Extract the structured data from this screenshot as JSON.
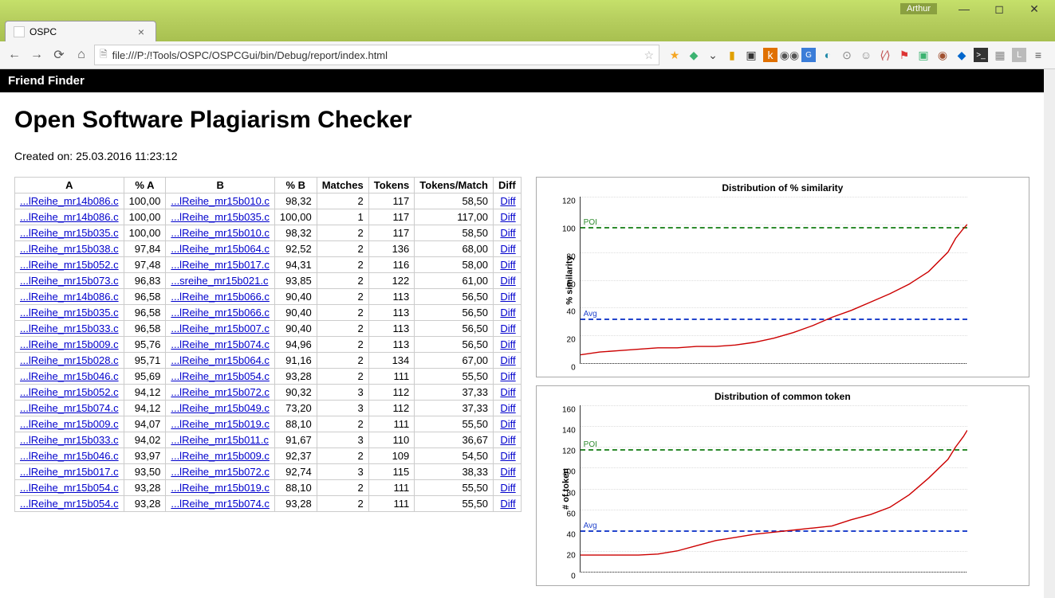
{
  "window": {
    "user": "Arthur"
  },
  "browser": {
    "tab_title": "OSPC",
    "url": "file:///P:/!Tools/OSPC/OSPCGui/bin/Debug/report/index.html"
  },
  "page": {
    "header": "Friend Finder",
    "title": "Open Software Plagiarism Checker",
    "created_label": "Created on:",
    "created_value": "25.03.2016 11:23:12"
  },
  "table": {
    "headers": {
      "a": "A",
      "pa": "% A",
      "b": "B",
      "pb": "% B",
      "matches": "Matches",
      "tokens": "Tokens",
      "tpm": "Tokens/Match",
      "diff": "Diff"
    },
    "diff_label": "Diff",
    "rows": [
      {
        "a": "...lReihe_mr14b086.c",
        "pa": "100,00",
        "b": "...lReihe_mr15b010.c",
        "pb": "98,32",
        "matches": "2",
        "tokens": "117",
        "tpm": "58,50"
      },
      {
        "a": "...lReihe_mr14b086.c",
        "pa": "100,00",
        "b": "...lReihe_mr15b035.c",
        "pb": "100,00",
        "matches": "1",
        "tokens": "117",
        "tpm": "117,00"
      },
      {
        "a": "...lReihe_mr15b035.c",
        "pa": "100,00",
        "b": "...lReihe_mr15b010.c",
        "pb": "98,32",
        "matches": "2",
        "tokens": "117",
        "tpm": "58,50"
      },
      {
        "a": "...lReihe_mr15b038.c",
        "pa": "97,84",
        "b": "...lReihe_mr15b064.c",
        "pb": "92,52",
        "matches": "2",
        "tokens": "136",
        "tpm": "68,00"
      },
      {
        "a": "...lReihe_mr15b052.c",
        "pa": "97,48",
        "b": "...lReihe_mr15b017.c",
        "pb": "94,31",
        "matches": "2",
        "tokens": "116",
        "tpm": "58,00"
      },
      {
        "a": "...lReihe_mr15b073.c",
        "pa": "96,83",
        "b": "...sreihe_mr15b021.c",
        "pb": "93,85",
        "matches": "2",
        "tokens": "122",
        "tpm": "61,00"
      },
      {
        "a": "...lReihe_mr14b086.c",
        "pa": "96,58",
        "b": "...lReihe_mr15b066.c",
        "pb": "90,40",
        "matches": "2",
        "tokens": "113",
        "tpm": "56,50"
      },
      {
        "a": "...lReihe_mr15b035.c",
        "pa": "96,58",
        "b": "...lReihe_mr15b066.c",
        "pb": "90,40",
        "matches": "2",
        "tokens": "113",
        "tpm": "56,50"
      },
      {
        "a": "...lReihe_mr15b033.c",
        "pa": "96,58",
        "b": "...lReihe_mr15b007.c",
        "pb": "90,40",
        "matches": "2",
        "tokens": "113",
        "tpm": "56,50"
      },
      {
        "a": "...lReihe_mr15b009.c",
        "pa": "95,76",
        "b": "...lReihe_mr15b074.c",
        "pb": "94,96",
        "matches": "2",
        "tokens": "113",
        "tpm": "56,50"
      },
      {
        "a": "...lReihe_mr15b028.c",
        "pa": "95,71",
        "b": "...lReihe_mr15b064.c",
        "pb": "91,16",
        "matches": "2",
        "tokens": "134",
        "tpm": "67,00"
      },
      {
        "a": "...lReihe_mr15b046.c",
        "pa": "95,69",
        "b": "...lReihe_mr15b054.c",
        "pb": "93,28",
        "matches": "2",
        "tokens": "111",
        "tpm": "55,50"
      },
      {
        "a": "...lReihe_mr15b052.c",
        "pa": "94,12",
        "b": "...lReihe_mr15b072.c",
        "pb": "90,32",
        "matches": "3",
        "tokens": "112",
        "tpm": "37,33"
      },
      {
        "a": "...lReihe_mr15b074.c",
        "pa": "94,12",
        "b": "...lReihe_mr15b049.c",
        "pb": "73,20",
        "matches": "3",
        "tokens": "112",
        "tpm": "37,33"
      },
      {
        "a": "...lReihe_mr15b009.c",
        "pa": "94,07",
        "b": "...lReihe_mr15b019.c",
        "pb": "88,10",
        "matches": "2",
        "tokens": "111",
        "tpm": "55,50"
      },
      {
        "a": "...lReihe_mr15b033.c",
        "pa": "94,02",
        "b": "...lReihe_mr15b011.c",
        "pb": "91,67",
        "matches": "3",
        "tokens": "110",
        "tpm": "36,67"
      },
      {
        "a": "...lReihe_mr15b046.c",
        "pa": "93,97",
        "b": "...lReihe_mr15b009.c",
        "pb": "92,37",
        "matches": "2",
        "tokens": "109",
        "tpm": "54,50"
      },
      {
        "a": "...lReihe_mr15b017.c",
        "pa": "93,50",
        "b": "...lReihe_mr15b072.c",
        "pb": "92,74",
        "matches": "3",
        "tokens": "115",
        "tpm": "38,33"
      },
      {
        "a": "...lReihe_mr15b054.c",
        "pa": "93,28",
        "b": "...lReihe_mr15b019.c",
        "pb": "88,10",
        "matches": "2",
        "tokens": "111",
        "tpm": "55,50"
      },
      {
        "a": "...lReihe_mr15b054.c",
        "pa": "93,28",
        "b": "...lReihe_mr15b074.c",
        "pb": "93,28",
        "matches": "2",
        "tokens": "111",
        "tpm": "55,50"
      }
    ]
  },
  "charts": {
    "top": {
      "title": "Distribution of % similarity",
      "ylabel": "% similarity",
      "ymax": 120,
      "yticks": [
        0,
        20,
        40,
        60,
        80,
        100,
        120
      ],
      "poi_label": "POI",
      "poi_value": 98,
      "avg_label": "Avg",
      "avg_value": 32
    },
    "bottom": {
      "title": "Distribution of common token",
      "ylabel": "# of token",
      "ymax": 160,
      "yticks": [
        0,
        20,
        40,
        60,
        80,
        100,
        120,
        140,
        160
      ],
      "poi_label": "POI",
      "poi_value": 118,
      "avg_label": "Avg",
      "avg_value": 40
    }
  },
  "chart_data": [
    {
      "type": "line",
      "title": "Distribution of % similarity",
      "xlabel": "",
      "ylabel": "% similarity",
      "ylim": [
        0,
        120
      ],
      "annotations": {
        "POI": 98,
        "Avg": 32
      },
      "series": [
        {
          "name": "similarity",
          "x": [
            0,
            0.05,
            0.1,
            0.15,
            0.2,
            0.25,
            0.3,
            0.35,
            0.4,
            0.45,
            0.5,
            0.55,
            0.6,
            0.65,
            0.7,
            0.75,
            0.8,
            0.85,
            0.9,
            0.95,
            0.97,
            0.99,
            1.0
          ],
          "values": [
            6,
            8,
            9,
            10,
            11,
            11,
            12,
            12,
            13,
            15,
            18,
            22,
            27,
            33,
            38,
            44,
            50,
            57,
            66,
            80,
            90,
            97,
            100
          ]
        }
      ]
    },
    {
      "type": "line",
      "title": "Distribution of common token",
      "xlabel": "",
      "ylabel": "# of token",
      "ylim": [
        0,
        160
      ],
      "annotations": {
        "POI": 118,
        "Avg": 40
      },
      "series": [
        {
          "name": "tokens",
          "x": [
            0,
            0.05,
            0.1,
            0.15,
            0.2,
            0.25,
            0.3,
            0.35,
            0.4,
            0.45,
            0.5,
            0.55,
            0.6,
            0.65,
            0.7,
            0.75,
            0.8,
            0.85,
            0.9,
            0.95,
            0.97,
            0.99,
            1.0
          ],
          "values": [
            16,
            16,
            16,
            16,
            17,
            20,
            25,
            30,
            33,
            36,
            38,
            40,
            42,
            44,
            50,
            55,
            62,
            74,
            90,
            108,
            120,
            130,
            136
          ]
        }
      ]
    }
  ]
}
